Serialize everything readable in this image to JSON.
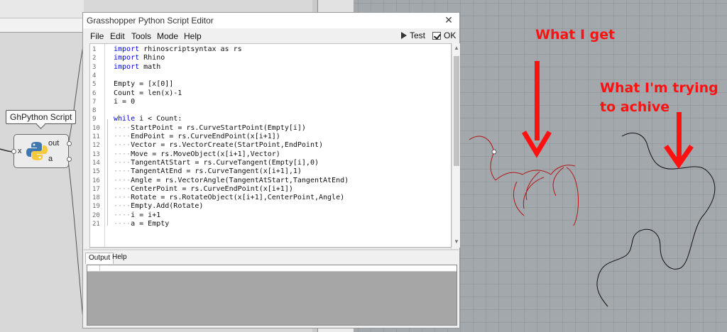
{
  "gh_component": {
    "tooltip": "GhPython Script",
    "input_label": "x",
    "output_out": "out",
    "output_a": "a"
  },
  "editor": {
    "title": "Grasshopper Python Script Editor",
    "close_glyph": "✕",
    "menu": [
      "File",
      "Edit",
      "Tools",
      "Mode",
      "Help"
    ],
    "test_label": "Test",
    "ok_label": "OK",
    "code": [
      {
        "n": "1",
        "indent": "",
        "kw": "import",
        "rest": " rhinoscriptsyntax as rs"
      },
      {
        "n": "2",
        "indent": "",
        "kw": "import",
        "rest": " Rhino"
      },
      {
        "n": "3",
        "indent": "",
        "kw": "import",
        "rest": " math"
      },
      {
        "n": "4",
        "indent": "",
        "kw": "",
        "rest": ""
      },
      {
        "n": "5",
        "indent": "",
        "kw": "",
        "rest": "Empty = [x[0]]"
      },
      {
        "n": "6",
        "indent": "",
        "kw": "",
        "rest": "Count = len(x)-1"
      },
      {
        "n": "7",
        "indent": "",
        "kw": "",
        "rest": "i = 0"
      },
      {
        "n": "8",
        "indent": "",
        "kw": "",
        "rest": ""
      },
      {
        "n": "9",
        "indent": "",
        "kw": "while",
        "rest": " i < Count:"
      },
      {
        "n": "10",
        "indent": "····",
        "kw": "",
        "rest": "StartPoint = rs.CurveStartPoint(Empty[i])"
      },
      {
        "n": "11",
        "indent": "····",
        "kw": "",
        "rest": "EndPoint = rs.CurveEndPoint(x[i+1])"
      },
      {
        "n": "12",
        "indent": "····",
        "kw": "",
        "rest": "Vector = rs.VectorCreate(StartPoint,EndPoint)"
      },
      {
        "n": "13",
        "indent": "····",
        "kw": "",
        "rest": "Move = rs.MoveObject(x[i+1],Vector)"
      },
      {
        "n": "14",
        "indent": "····",
        "kw": "",
        "rest": "TangentAtStart = rs.CurveTangent(Empty[i],0)"
      },
      {
        "n": "15",
        "indent": "····",
        "kw": "",
        "rest": "TangentAtEnd = rs.CurveTangent(x[i+1],1)"
      },
      {
        "n": "16",
        "indent": "····",
        "kw": "",
        "rest": "Angle = rs.VectorAngle(TangentAtStart,TangentAtEnd)"
      },
      {
        "n": "17",
        "indent": "····",
        "kw": "",
        "rest": "CenterPoint = rs.CurveEndPoint(x[i+1])"
      },
      {
        "n": "18",
        "indent": "····",
        "kw": "",
        "rest": "Rotate = rs.RotateObject(x[i+1],CenterPoint,Angle)"
      },
      {
        "n": "19",
        "indent": "····",
        "kw": "",
        "rest": "Empty.Add(Rotate)"
      },
      {
        "n": "20",
        "indent": "····",
        "kw": "",
        "rest": "i = i+1"
      },
      {
        "n": "21",
        "indent": "····",
        "kw": "",
        "rest": "a = Empty"
      }
    ],
    "output_tabs": [
      "Output",
      "Help"
    ]
  },
  "annotations": {
    "what_i_get": "What I get",
    "trying_line1": "What I'm trying",
    "trying_line2": "to achive"
  },
  "colors": {
    "annotation": "#ff1111",
    "red_curve": "#b01818",
    "black_curve": "#111111",
    "keyword": "#0000dd"
  }
}
